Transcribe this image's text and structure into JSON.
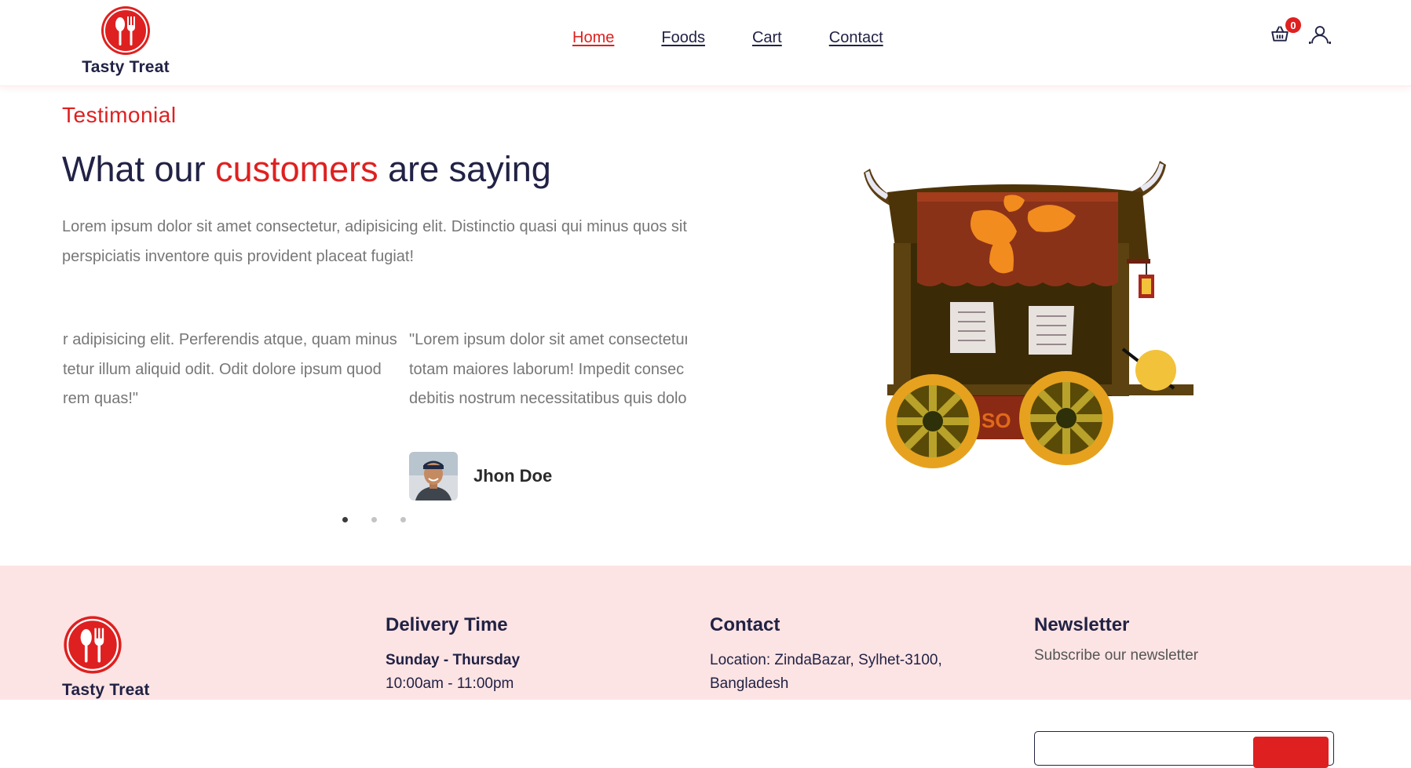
{
  "brand": {
    "name": "Tasty Treat",
    "accent_color": "#df2020",
    "text_color": "#212245",
    "logo_icon": "spoon-fork-icon"
  },
  "nav": {
    "items": [
      {
        "label": "Home",
        "active": true
      },
      {
        "label": "Foods",
        "active": false
      },
      {
        "label": "Cart",
        "active": false
      },
      {
        "label": "Contact",
        "active": false
      }
    ]
  },
  "header_actions": {
    "cart_icon": "shopping-basket-icon",
    "cart_count": "0",
    "user_icon": "user-icon"
  },
  "testimonial": {
    "subtitle": "Testimonial",
    "title_part1": "What our ",
    "title_highlight": "customers",
    "title_part2": " are saying",
    "description": "Lorem ipsum dolor sit amet consectetur, adipisicing elit. Distinctio quasi qui minus quos sit perspiciatis inventore quis provident placeat fugiat!",
    "slides": [
      {
        "line1": "r adipisicing elit. Perferendis atque, quam minus",
        "line2": "tetur illum aliquid odit. Odit dolore ipsum quod",
        "line3": "rem quas!\""
      },
      {
        "line1": "\"Lorem ipsum dolor sit amet consectetur",
        "line2": "totam maiores laborum! Impedit consec",
        "line3": "debitis nostrum necessitatibus quis dolo"
      }
    ],
    "author_name": "Jhon Doe",
    "active_dot": 0,
    "dot_count": 3
  },
  "footer": {
    "brand_name": "Tasty Treat",
    "delivery": {
      "heading": "Delivery Time",
      "days": "Sunday - Thursday",
      "hours": "10:00am - 11:00pm"
    },
    "contact": {
      "heading": "Contact",
      "location_line1": "Location: ZindaBazar, Sylhet-3100,",
      "location_line2": "Bangladesh"
    },
    "newsletter": {
      "heading": "Newsletter",
      "subtitle": "Subscribe our newsletter"
    },
    "background_color": "#fde4e4"
  }
}
